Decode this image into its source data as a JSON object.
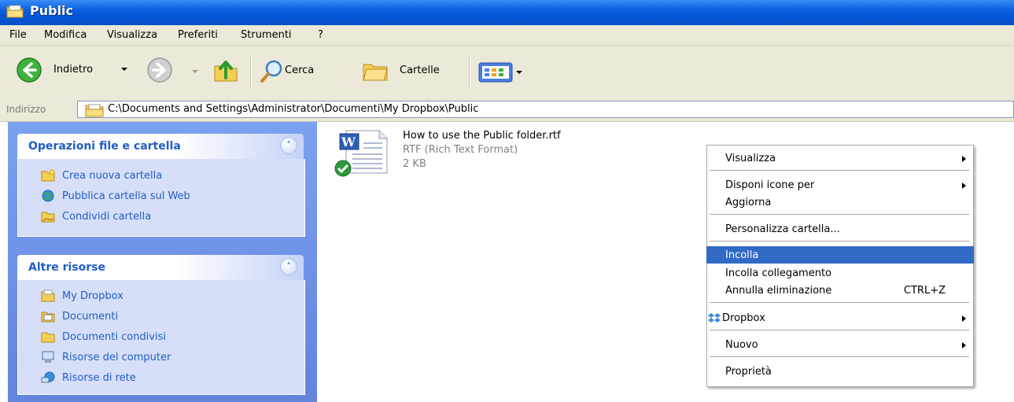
{
  "window": {
    "title": "Public"
  },
  "menubar": [
    "File",
    "Modifica",
    "Visualizza",
    "Preferiti",
    "Strumenti",
    "?"
  ],
  "toolbar": {
    "back_label": "Indietro",
    "search_label": "Cerca",
    "folders_label": "Cartelle"
  },
  "address": {
    "label": "Indirizzo",
    "path": "C:\\Documents and Settings\\Administrator\\Documenti\\My Dropbox\\Public"
  },
  "taskpane": {
    "file_tasks": {
      "title": "Operazioni file e cartella",
      "items": [
        {
          "label": "Crea nuova cartella",
          "icon": "new-folder-icon"
        },
        {
          "label": "Pubblica cartella sul Web",
          "icon": "publish-web-icon"
        },
        {
          "label": "Condividi cartella",
          "icon": "share-folder-icon"
        }
      ]
    },
    "other_places": {
      "title": "Altre risorse",
      "items": [
        {
          "label": "My Dropbox",
          "icon": "dropbox-folder-icon"
        },
        {
          "label": "Documenti",
          "icon": "documents-icon"
        },
        {
          "label": "Documenti condivisi",
          "icon": "shared-documents-icon"
        },
        {
          "label": "Risorse del computer",
          "icon": "my-computer-icon"
        },
        {
          "label": "Risorse di rete",
          "icon": "network-icon"
        }
      ]
    }
  },
  "file": {
    "name": "How to use the Public folder.rtf",
    "type": "RTF (Rich Text Format)",
    "size": "2 KB"
  },
  "context_menu": {
    "items": [
      {
        "label": "Visualizza",
        "submenu": true
      },
      {
        "label": "Disponi icone per",
        "submenu": true
      },
      {
        "label": "Aggiorna",
        "submenu": false
      },
      {
        "label": "Personalizza cartella...",
        "submenu": false
      },
      {
        "label": "Incolla",
        "submenu": false,
        "highlighted": true
      },
      {
        "label": "Incolla collegamento",
        "submenu": false
      },
      {
        "label": "Annulla eliminazione",
        "submenu": false,
        "shortcut": "CTRL+Z"
      },
      {
        "label": "Dropbox",
        "submenu": true
      },
      {
        "label": "Nuovo",
        "submenu": true
      },
      {
        "label": "Proprietà",
        "submenu": false
      }
    ]
  },
  "colors": {
    "titlebar": "#0a5fe0",
    "taskpane_bg": "#6b8fe0",
    "link": "#215dc6",
    "menu_highlight": "#316ac5"
  }
}
